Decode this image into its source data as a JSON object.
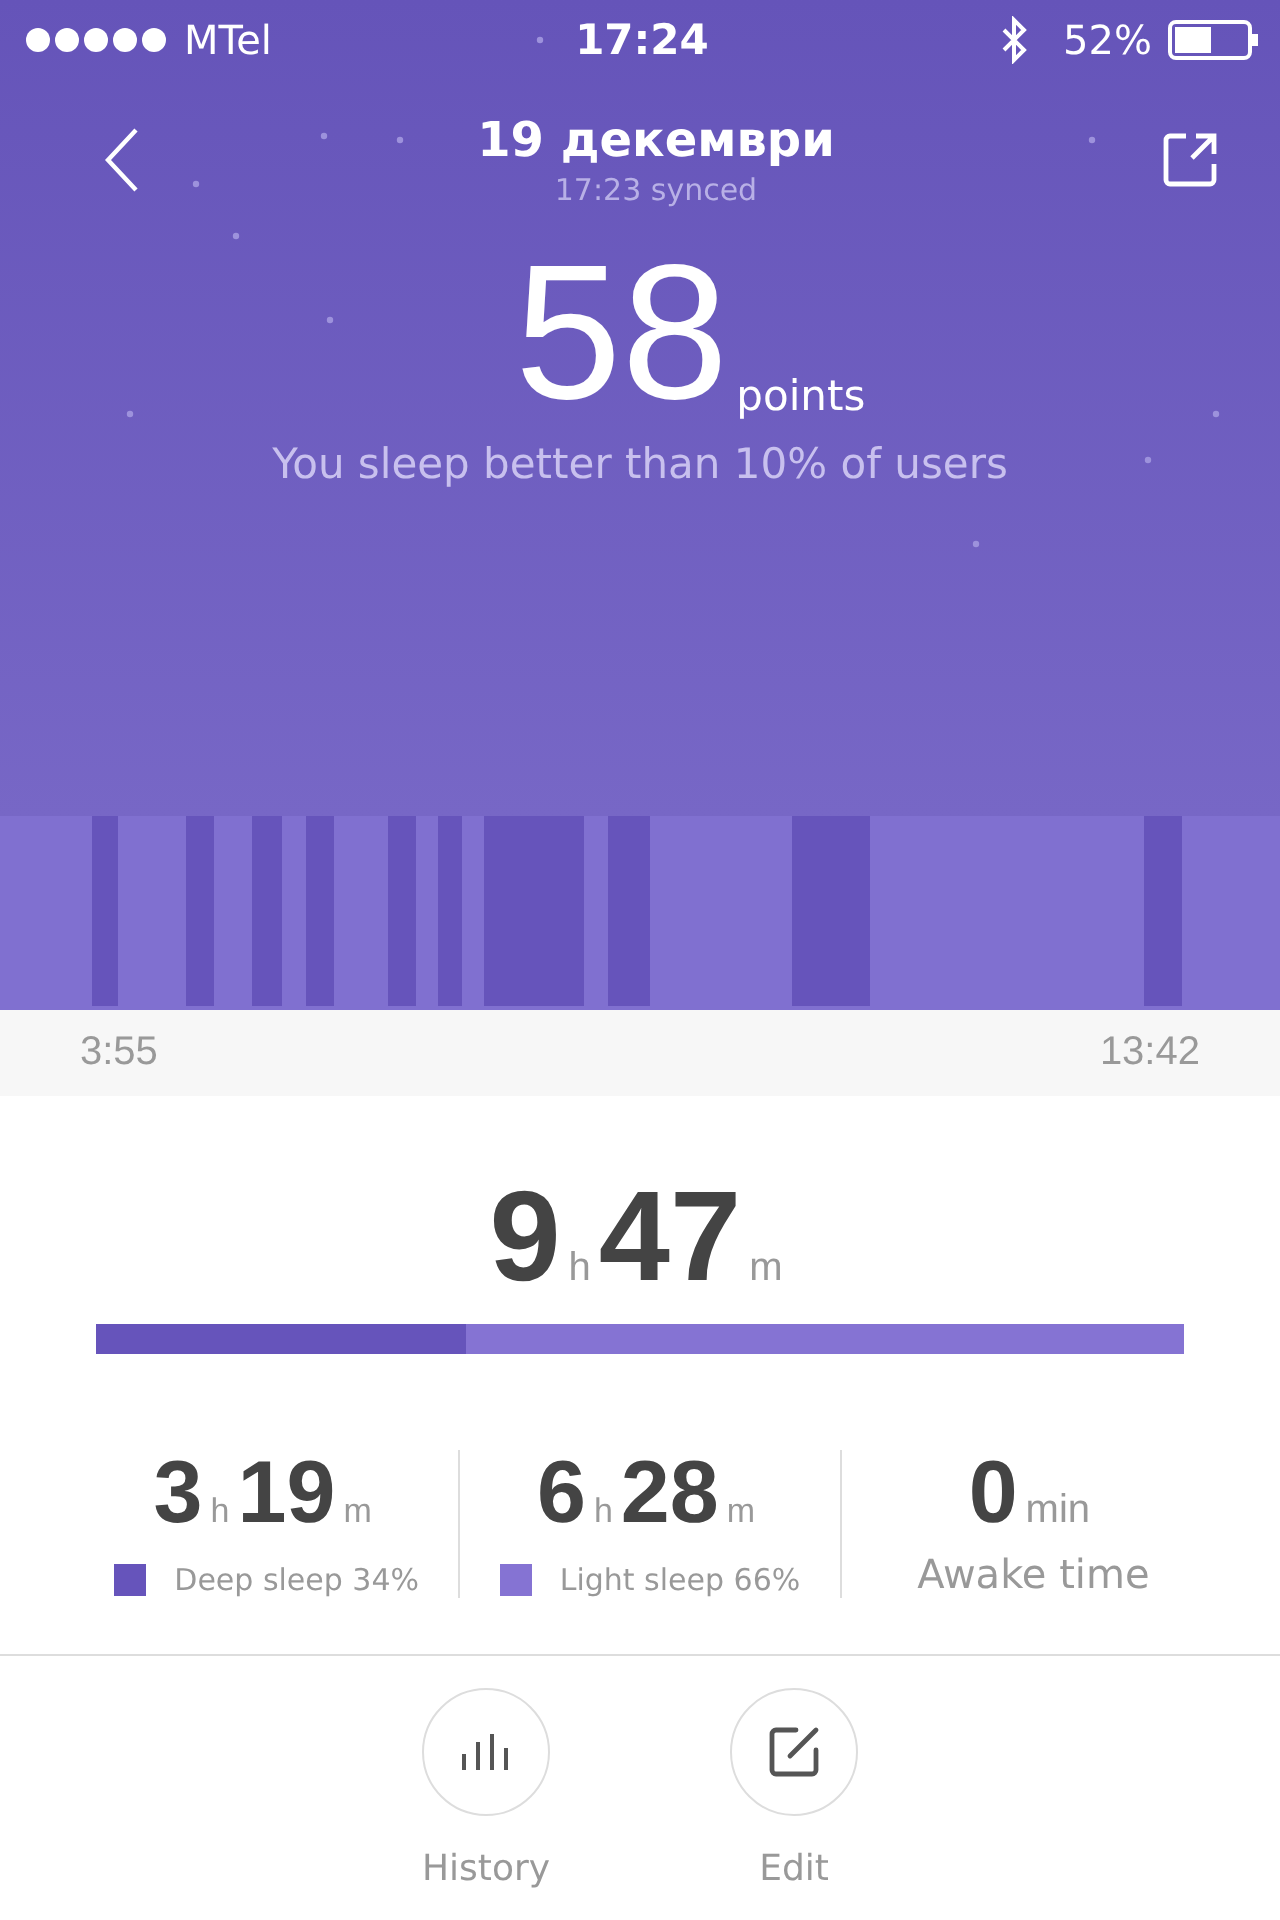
{
  "status_bar": {
    "carrier": "MTel",
    "time": "17:24",
    "battery": "52%"
  },
  "header": {
    "title": "19 декември",
    "subtitle": "17:23 synced"
  },
  "score": {
    "value": "58",
    "unit": "points",
    "caption": "You sleep better than 10% of users"
  },
  "timeline": {
    "start": "3:55",
    "end": "13:42"
  },
  "total": {
    "hours": "9",
    "h_unit": "h",
    "minutes": "47",
    "m_unit": "m",
    "level": 0.34
  },
  "stats": [
    {
      "kind": "duration",
      "hours": "3",
      "h_unit": "h",
      "minutes": "19",
      "m_unit": "m",
      "label": "Deep sleep 34%",
      "color": "#6654bb"
    },
    {
      "kind": "duration",
      "hours": "6",
      "h_unit": "h",
      "minutes": "28",
      "m_unit": "m",
      "label": "Light sleep 66%",
      "color": "#8573d3"
    },
    {
      "kind": "count",
      "value": "0",
      "unit": "min",
      "label": "Awake time"
    }
  ],
  "actions": [
    {
      "kind": "history",
      "label": "History"
    },
    {
      "kind": "edit",
      "label": "Edit"
    }
  ]
}
